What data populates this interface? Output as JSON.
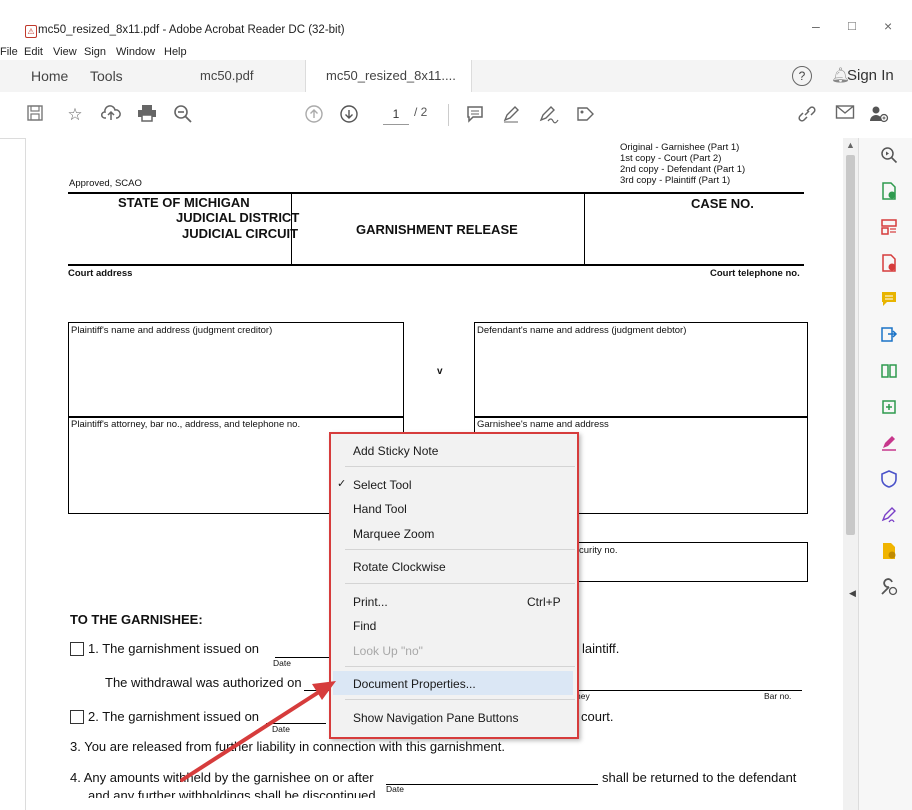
{
  "window": {
    "title": "mc50_resized_8x11.pdf - Adobe Acrobat Reader DC (32-bit)",
    "minimize": "–",
    "maximize": "□",
    "close": "×"
  },
  "menu": [
    "File",
    "Edit",
    "View",
    "Sign",
    "Window",
    "Help"
  ],
  "tabs": {
    "home": "Home",
    "tools": "Tools",
    "doc1": "mc50.pdf",
    "doc2": "mc50_resized_8x11....",
    "doc2_close": "×",
    "sign_in": "Sign In",
    "help": "?"
  },
  "toolbar": {
    "page_current": "1",
    "page_total": "/ 2"
  },
  "form": {
    "copies": [
      "Original - Garnishee (Part 1)",
      "1st copy - Court (Part 2)",
      "2nd copy - Defendant (Part 1)",
      "3rd copy - Plaintiff (Part 1)"
    ],
    "approved": "Approved, SCAO",
    "state": "STATE OF MICHIGAN",
    "district": "JUDICIAL DISTRICT",
    "circuit": "JUDICIAL CIRCUIT",
    "title": "GARNISHMENT RELEASE",
    "case_no": "CASE NO.",
    "court_address": "Court address",
    "court_phone": "Court telephone no.",
    "plaintiff": "Plaintiff's name and address (judgment creditor)",
    "defendant": "Defendant's name and address (judgment debtor)",
    "versus": "v",
    "attorney": "Plaintiff's attorney, bar no., address, and telephone no.",
    "garnishee": "Garnishee's name and address",
    "security": "curity no.",
    "to_garnishee": "TO THE GARNISHEE:",
    "item1": "1. The garnishment issued on",
    "item1_end": "laintiff.",
    "date": "Date",
    "withdrawal": "The withdrawal was authorized on",
    "attorney_sig": "ney",
    "bar_no": "Bar no.",
    "item2": "2. The garnishment issued on",
    "item2_end": "court.",
    "item3": "3. You are released from further liability in connection with this garnishment.",
    "item4": "4. Any amounts withheld by the garnishee on or after",
    "item4_end": "shall be returned to the defendant",
    "item4_next": "and any further withholdings shall be discontinued."
  },
  "context_menu": {
    "items": [
      {
        "label": "Add Sticky Note",
        "shortcut": "",
        "disabled": false
      },
      {
        "label": "Select Tool",
        "shortcut": "",
        "disabled": false,
        "checked": true
      },
      {
        "label": "Hand Tool",
        "shortcut": "",
        "disabled": false
      },
      {
        "label": "Marquee Zoom",
        "shortcut": "",
        "disabled": false
      },
      {
        "label": "Rotate Clockwise",
        "shortcut": "",
        "disabled": false
      },
      {
        "label": "Print...",
        "shortcut": "Ctrl+P",
        "disabled": false
      },
      {
        "label": "Find",
        "shortcut": "",
        "disabled": false
      },
      {
        "label": "Look Up \"no\"",
        "shortcut": "",
        "disabled": true
      },
      {
        "label": "Document Properties...",
        "shortcut": "",
        "disabled": false,
        "highlighted": true
      },
      {
        "label": "Show Navigation Pane Buttons",
        "shortcut": "",
        "disabled": false
      }
    ],
    "check": "✓"
  },
  "colors": {
    "accent_red": "#d63c3c",
    "highlight": "#dbe7f5"
  },
  "icons": [
    "save-icon",
    "bookmark-star-icon",
    "upload-cloud-icon",
    "print-icon",
    "zoom-out-icon",
    "page-up-icon",
    "page-down-icon",
    "comment-icon",
    "pen-icon",
    "sign-icon",
    "stamp-icon",
    "share-link-icon",
    "mail-icon",
    "add-user-icon"
  ]
}
